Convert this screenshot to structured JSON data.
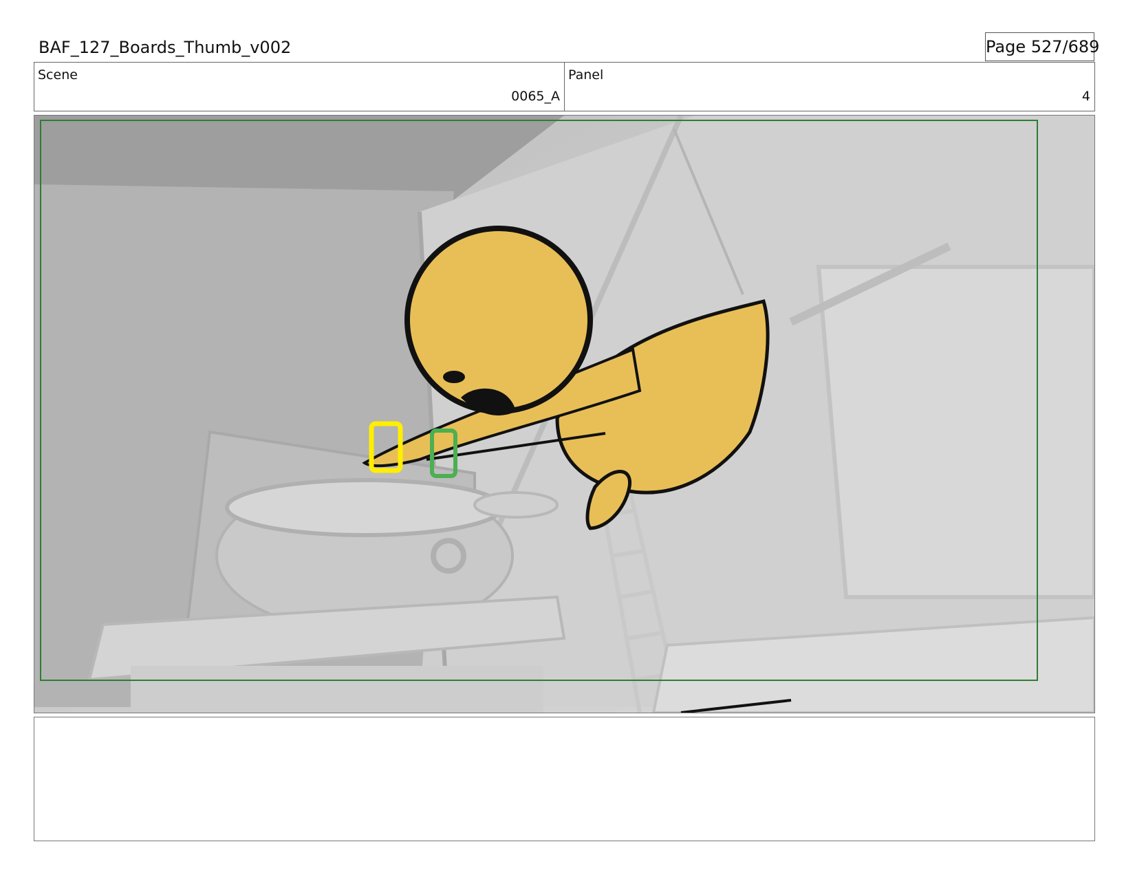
{
  "header": {
    "title": "BAF_127_Boards_Thumb_v002",
    "page": "Page 527/689"
  },
  "fields": {
    "scene_label": "Scene",
    "scene_value": "0065_A",
    "panel_label": "Panel",
    "panel_value": "4"
  },
  "panel_image": {
    "description_colors": {
      "background_gray": "#cfcfcf",
      "character_fill": "#e8bf57",
      "outline": "#111111",
      "safe_frame": "#2e7d32",
      "yellow_glass": "#ffee00",
      "green_glass": "#4caf50"
    }
  },
  "notes": {
    "text": ""
  }
}
